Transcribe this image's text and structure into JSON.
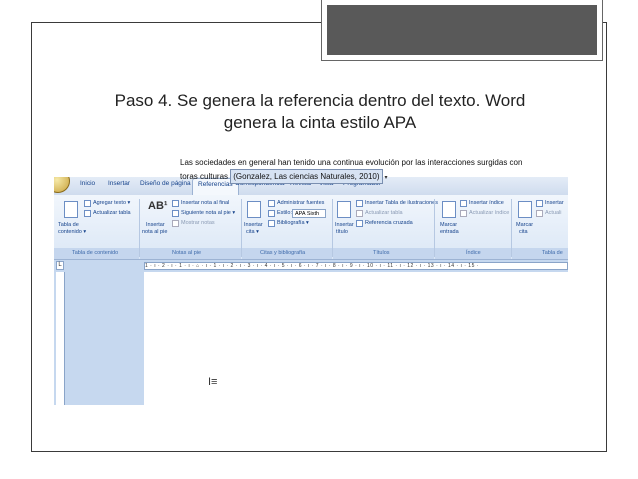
{
  "slide": {
    "title_line1": "Paso 4.  Se genera la referencia dentro del texto. Word",
    "title_line2": "genera la cinta estilo APA"
  },
  "word": {
    "tabs": [
      "Inicio",
      "Insertar",
      "Diseño de página",
      "Referencias",
      "Correspondencia",
      "Revisar",
      "Vista",
      "Programador"
    ],
    "ribbon": {
      "toc_label_1": "Tabla de",
      "toc_label_2": "contenido ▾",
      "add_text": "Agregar texto ▾",
      "update_table": "Actualizar tabla",
      "insert_footnote_1": "Insertar",
      "insert_footnote_2": "nota al pie",
      "insert_endnote": "Insertar nota al final",
      "next_footnote": "Siguiente nota al pie ▾",
      "show_notes": "Mostrar notas",
      "insert_citation_1": "Insertar",
      "insert_citation_2": "cita ▾",
      "manage_sources": "Administrar fuentes",
      "style_label": "Estilo:",
      "style_value": "APA Sixth",
      "bibliography": "Bibliografía ▾",
      "insert_caption_1": "Insertar",
      "insert_caption_2": "título",
      "insert_table_figures": "Insertar Tabla de ilustraciones",
      "update_table_2": "Actualizar tabla",
      "cross_reference": "Referencia cruzada",
      "mark_entry_1": "Marcar",
      "mark_entry_2": "entrada",
      "insert_index": "Insertar índice",
      "update_index": "Actualizar índice",
      "mark_citation_1": "Marcar",
      "mark_citation_2": "cita",
      "insert_toa": "Insertar",
      "update_toa": "Actuali",
      "groups": [
        "Tabla de contenido",
        "Notas al pie",
        "Citas y bibliografía",
        "Títulos",
        "Índice",
        "Tabla de"
      ]
    },
    "ruler_text": "1 · ı · 2 · ı · 1 · ı · ⌂ · ı · 1 · ı · 2 · ı · 3 · ı · 4 · ı · 5 · ı · 6 · ı · 7 · ı · 8 · ı · 9 · ı · 10 · ı · 11 · ı · 12 · ı · 13 · ı · 14 · ı · 15 ·",
    "ruler_corner": "L",
    "document": {
      "line1": "Las sociedades en general han tenido una continua evolución por las interacciones surgidas con",
      "line2_prefix": "toras culturas ",
      "citation": "(Gonzalez, Las ciencias Naturales, 2010)",
      "citation_arrow": "▾",
      "cursor_glyph": "I≡"
    }
  }
}
